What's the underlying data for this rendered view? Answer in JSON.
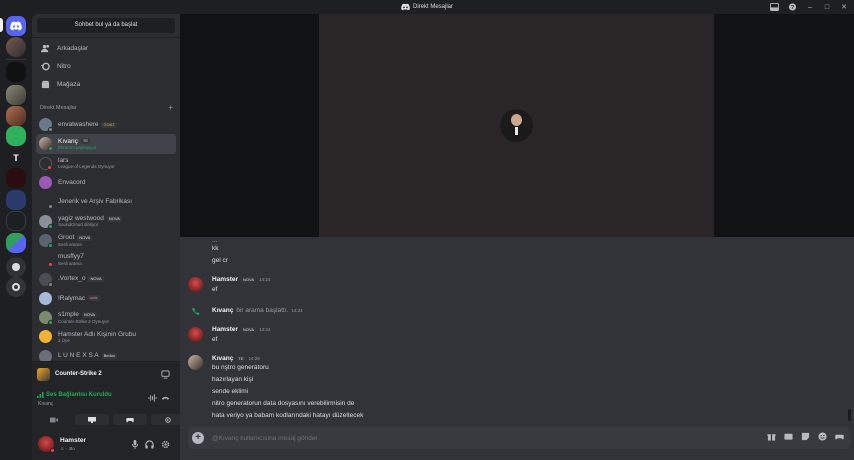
{
  "window": {
    "title": "Direkt Mesajlar"
  },
  "sidebar": {
    "search_label": "Sohbet bul ya da başlat",
    "nav": [
      {
        "label": "Arkadaşlar"
      },
      {
        "label": "Nitro"
      },
      {
        "label": "Mağaza"
      }
    ],
    "dm_header": "Direkt Mesajlar",
    "dm_add": "+",
    "dms": [
      {
        "name": "envatwashere",
        "badge": "GOAT",
        "sub": ""
      },
      {
        "name": "Kıvanç",
        "badge": "TE",
        "sub": "Ekranını paylaşıyor"
      },
      {
        "name": "lars",
        "badge": "",
        "sub": "League of Legends Oynuyor"
      },
      {
        "name": "Envacord",
        "badge": "",
        "sub": ""
      },
      {
        "name": "Jenerik ve Arşiv Fabrikası",
        "badge": "",
        "sub": ""
      },
      {
        "name": "yagiz westwood",
        "badge": "NOVA",
        "sub": "SoundCloud dinliyor"
      },
      {
        "name": "Groot",
        "badge": "NOVA",
        "sub": "Sesli arama"
      },
      {
        "name": "musffyy7",
        "badge": "",
        "sub": "Sesli arama"
      },
      {
        "name": ".Vortex_o",
        "badge": "NOVA",
        "sub": ""
      },
      {
        "name": "!Ralymac",
        "badge": "cute",
        "sub": ""
      },
      {
        "name": "s1mple",
        "badge": "NOVA",
        "sub": "Counter-Strike 2 Oynuyor"
      },
      {
        "name": "Hamster Adlı Kişinin Grubu",
        "badge": "",
        "sub": "1 Üye"
      },
      {
        "name": "L U N E X S A",
        "badge": "Beduo",
        "sub": ""
      }
    ]
  },
  "game_panel": {
    "game": "Counter-Strike 2"
  },
  "voice_panel": {
    "status": "Ses Bağlantısı Kuruldu",
    "channel": "Kıvanç"
  },
  "user_panel": {
    "name": "Hamster",
    "status": "Bo"
  },
  "messages": {
    "items": [
      {
        "type": "cont",
        "text": "kk"
      },
      {
        "type": "cont",
        "text": "gel cr"
      },
      {
        "type": "head",
        "author": "Hamster",
        "badge": "NOVA",
        "time": "14:24",
        "lines": [
          "ef"
        ]
      },
      {
        "type": "system",
        "author": "Kıvanç",
        "text": "bir arama başlattı.",
        "time": "14:24"
      },
      {
        "type": "head",
        "author": "Hamster",
        "badge": "NOVA",
        "time": "14:24",
        "lines": [
          "ef"
        ]
      },
      {
        "type": "head",
        "author": "Kıvanç",
        "badge": "TE",
        "time": "14:29",
        "lines": [
          "bu nştro generatoru",
          "hazırlayan kişi",
          "sende eklimi",
          "nitro generatorun data dosyasını verebilirmisin de",
          "hata veriyo ya babam kodlarındaki hatayı düzeltecek"
        ]
      }
    ]
  },
  "composer": {
    "placeholder": "@Kıvanç kullanıcısına mesaj gönder"
  },
  "colors": {
    "accent": "#5865f2",
    "online": "#23a55a",
    "dnd": "#f23f43",
    "idle": "#f0b232",
    "voice_connected": "#23a55a"
  }
}
